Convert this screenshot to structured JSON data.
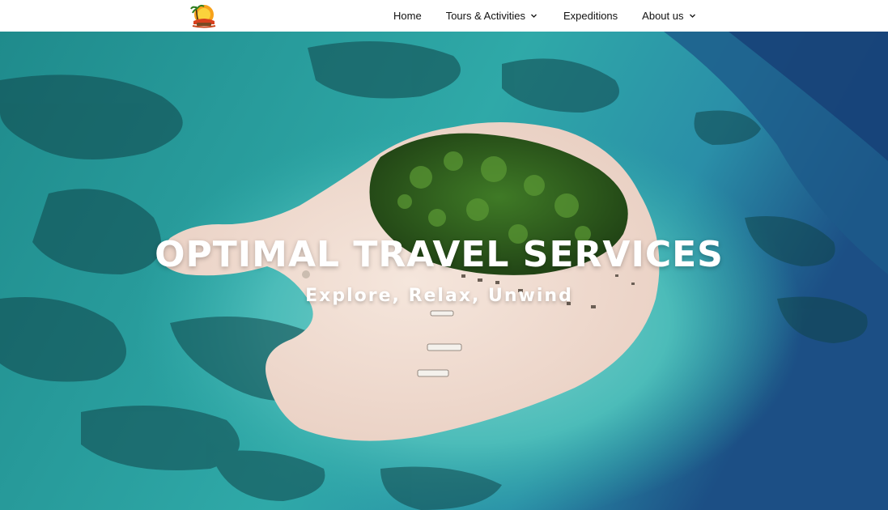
{
  "nav": {
    "logo_icon": "sunset-palm-logo-icon",
    "items": [
      {
        "label": "Home",
        "has_dropdown": false
      },
      {
        "label": "Tours & Activities",
        "has_dropdown": true
      },
      {
        "label": "Expeditions",
        "has_dropdown": false
      },
      {
        "label": "About us",
        "has_dropdown": true
      }
    ]
  },
  "hero": {
    "title": "OPTIMAL TRAVEL SERVICES",
    "subtitle": "Explore, Relax, Unwind",
    "background": "aerial-island-photo"
  },
  "colors": {
    "nav_background": "#ffffff",
    "nav_text": "#111111",
    "hero_text": "#ffffff",
    "sea": "#2aa4a4",
    "deep_sea": "#1d4f7a",
    "sand": "#f1ddd2",
    "forest": "#2f5a1d"
  }
}
